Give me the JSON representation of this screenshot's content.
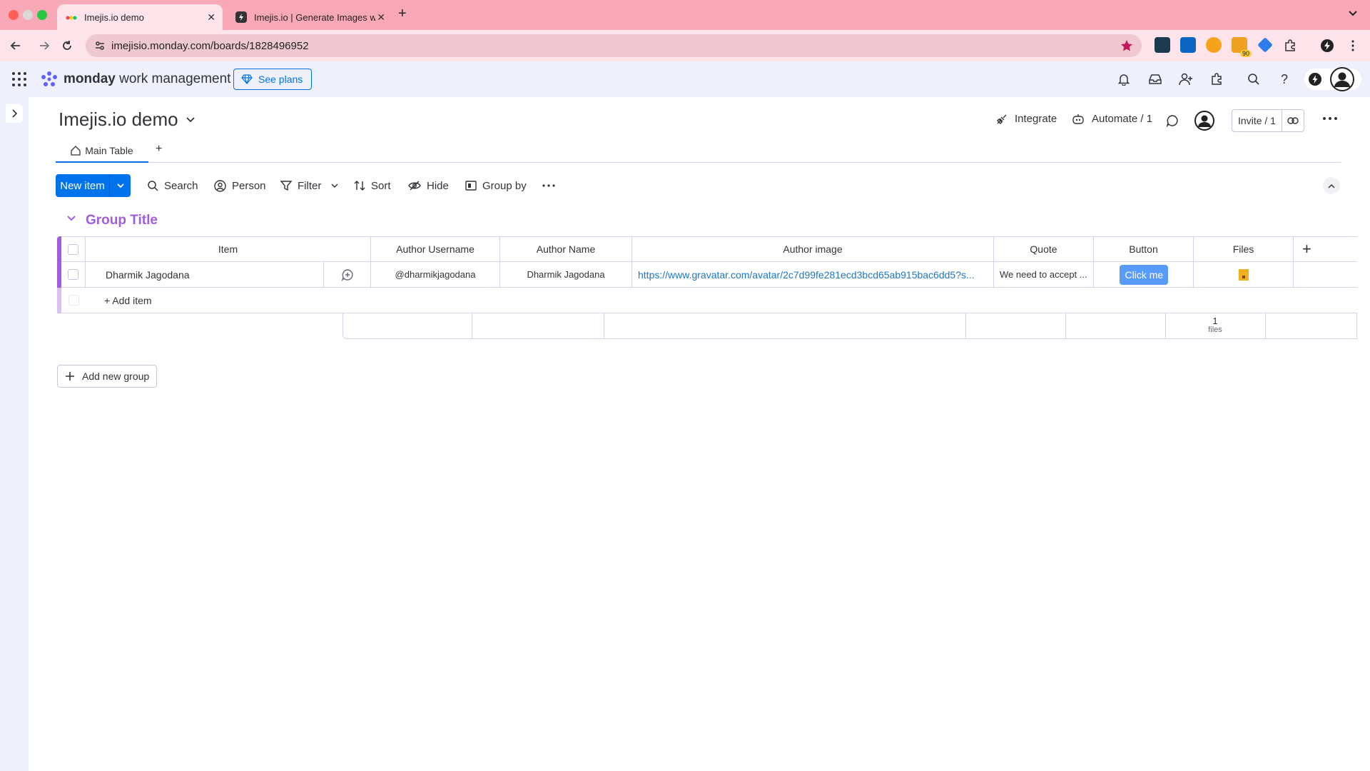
{
  "browser": {
    "tabs": [
      {
        "title": "Imejis.io demo",
        "active": true
      },
      {
        "title": "Imejis.io | Generate Images w",
        "active": false
      }
    ],
    "url": "imejisio.monday.com/boards/1828496952",
    "extension_badge": "90"
  },
  "app": {
    "brand": "monday",
    "product": "work management",
    "see_plans": "See plans"
  },
  "board": {
    "title": "Imejis.io demo",
    "views": [
      {
        "label": "Main Table"
      }
    ],
    "add_view": "+",
    "integrate": "Integrate",
    "automate": "Automate / 1",
    "invite": "Invite / 1"
  },
  "toolbar": {
    "new_item": "New item",
    "search": "Search",
    "person": "Person",
    "filter": "Filter",
    "sort": "Sort",
    "hide": "Hide",
    "group_by": "Group by"
  },
  "group": {
    "title": "Group Title",
    "color": "#a25ddc",
    "columns": [
      "Item",
      "Author Username",
      "Author Name",
      "Author image",
      "Quote",
      "Button",
      "Files"
    ],
    "add_column": "+",
    "rows": [
      {
        "item": "Dharmik Jagodana",
        "author_username": "@dharmikjagodana",
        "author_name": "Dharmik Jagodana",
        "author_image": "https://www.gravatar.com/avatar/2c7d99fe281ecd3bcd65ab915bac6dd5?s...",
        "quote": "We need to accept ...",
        "button": "Click me"
      }
    ],
    "add_item": "+ Add item",
    "summary": {
      "files_count": "1",
      "files_label": "files"
    }
  },
  "add_group": "Add new group",
  "colors": {
    "primary": "#0073ea",
    "button_cell": "#579bfc",
    "tab_bar": "#f9a8b8",
    "link": "#1f76c2"
  }
}
